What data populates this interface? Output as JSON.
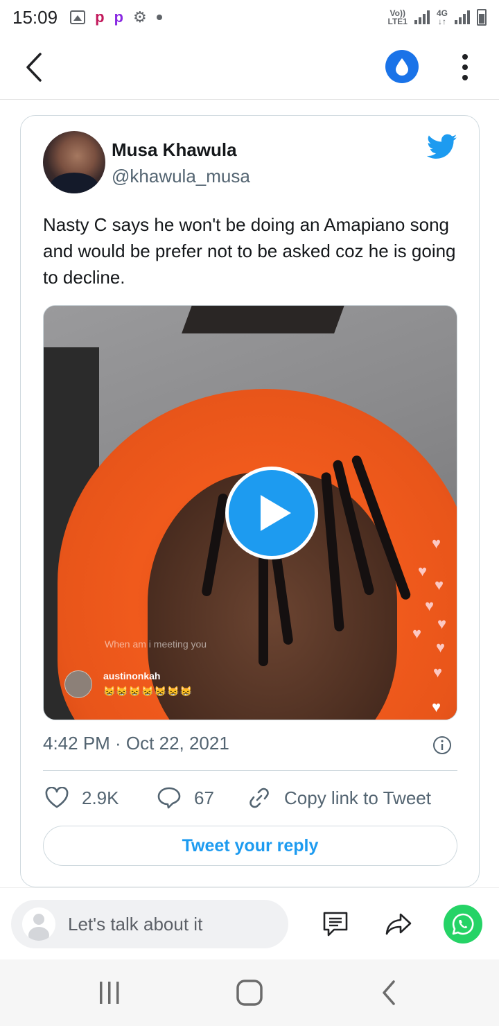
{
  "status_bar": {
    "time": "15:09",
    "net1_top": "Vo))",
    "net1_bottom": "LTE1",
    "net2_top": "4G",
    "net2_bottom": "↓↑"
  },
  "header": {
    "back_icon": "chevron-left-icon",
    "action_icon": "water-drop-icon",
    "accent_color": "#1a73e8"
  },
  "tweet": {
    "author_name": "Musa Khawula",
    "author_handle": "@khawula_musa",
    "text": "Nasty C says he won't be doing an Amapiano song and would be prefer not to be asked coz he is going to decline.",
    "timestamp": "4:42 PM · Oct 22, 2021",
    "likes": "2.9K",
    "replies": "67",
    "copy_link_label": "Copy link to Tweet",
    "reply_button_label": "Tweet your reply",
    "brand_color": "#1d9bf0",
    "media": {
      "overlay_comment": "When am i meeting you",
      "overlay_username": "austinonkah",
      "overlay_emojis": "😸😸😸😸😸😸😸"
    }
  },
  "comment_bar": {
    "placeholder": "Let's talk about it",
    "whatsapp_color": "#25d366"
  }
}
